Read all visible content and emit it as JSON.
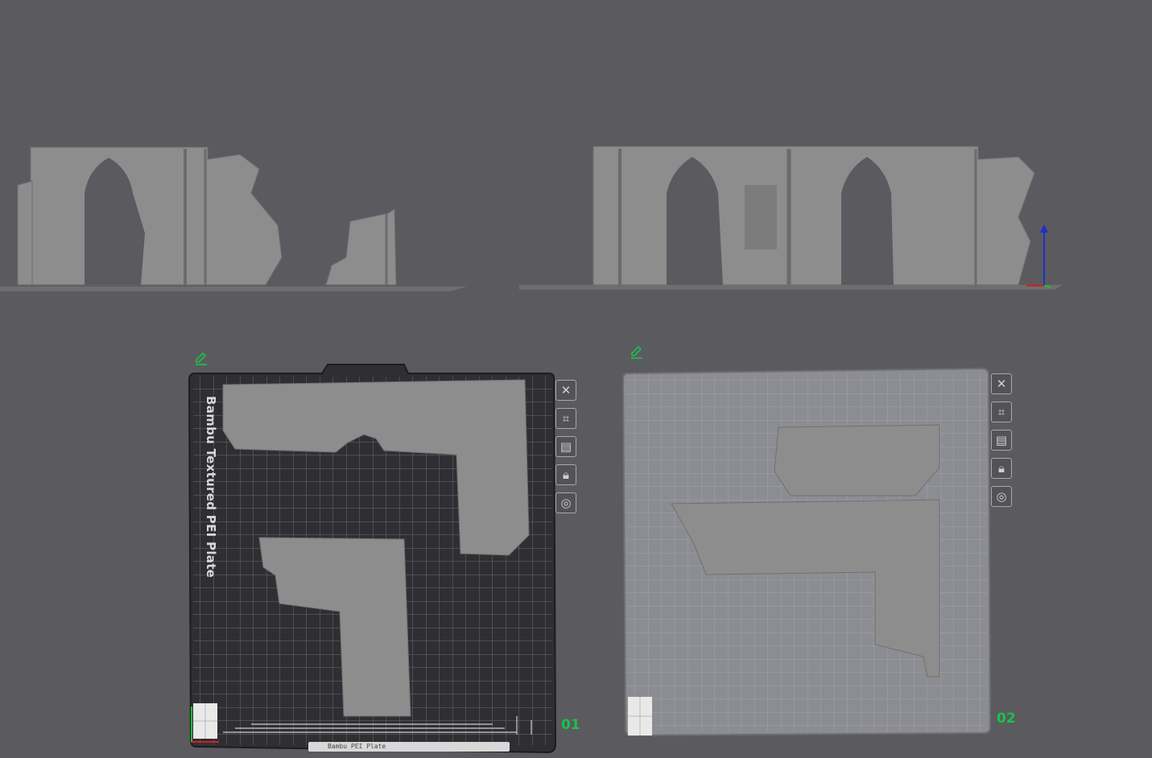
{
  "viewport": {
    "background": "#5b5a5f"
  },
  "plates": [
    {
      "number": "01",
      "bed_name": "Bambu Textured PEI Plate",
      "bed_color": "#2f2f33",
      "status_text": "Bambu PEI Plate",
      "edit_icon": "pencil-icon",
      "tools": [
        "close-icon",
        "auto-orient-icon",
        "arrange-icon",
        "lock-icon",
        "settings-icon"
      ]
    },
    {
      "number": "02",
      "bed_color": "#8c8c93",
      "edit_icon": "pencil-icon",
      "tools": [
        "close-icon",
        "auto-orient-icon",
        "arrange-icon",
        "lock-icon",
        "settings-icon"
      ]
    }
  ],
  "colors": {
    "plate_number": "#19c24c",
    "model": "#8d8d8d",
    "axis_z": "#1e2fd0",
    "axis_x": "#d02020",
    "axis_y": "#20c030"
  }
}
